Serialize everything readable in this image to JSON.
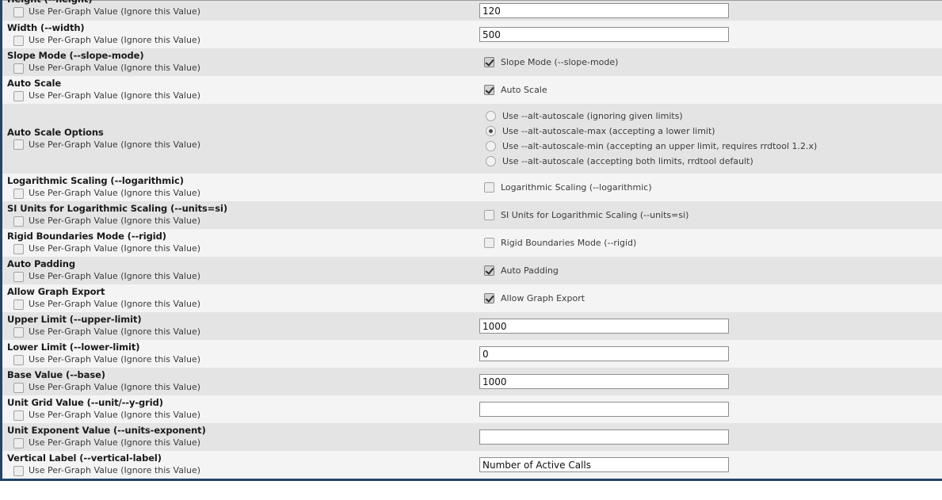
{
  "per_graph_label": "Use Per-Graph Value (Ignore this Value)",
  "rows": [
    {
      "title": "Height (--height)",
      "title_clipped": true,
      "control": "text",
      "value": "120"
    },
    {
      "title": "Width (--width)",
      "control": "text",
      "value": "500"
    },
    {
      "title": "Slope Mode (--slope-mode)",
      "control": "checkbox",
      "checkbox_label": "Slope Mode (--slope-mode)",
      "checked": true
    },
    {
      "title": "Auto Scale",
      "control": "checkbox",
      "checkbox_label": "Auto Scale",
      "checked": true
    },
    {
      "title": "Auto Scale Options",
      "control": "radio",
      "options": [
        {
          "label": "Use --alt-autoscale (ignoring given limits)",
          "selected": false
        },
        {
          "label": "Use --alt-autoscale-max (accepting a lower limit)",
          "selected": true
        },
        {
          "label": "Use --alt-autoscale-min (accepting an upper limit, requires rrdtool 1.2.x)",
          "selected": false
        },
        {
          "label": "Use --alt-autoscale (accepting both limits, rrdtool default)",
          "selected": false
        }
      ]
    },
    {
      "title": "Logarithmic Scaling (--logarithmic)",
      "control": "checkbox",
      "checkbox_label": "Logarithmic Scaling (--logarithmic)",
      "checked": false
    },
    {
      "title": "SI Units for Logarithmic Scaling (--units=si)",
      "control": "checkbox",
      "checkbox_label": "SI Units for Logarithmic Scaling (--units=si)",
      "checked": false
    },
    {
      "title": "Rigid Boundaries Mode (--rigid)",
      "control": "checkbox",
      "checkbox_label": "Rigid Boundaries Mode (--rigid)",
      "checked": false
    },
    {
      "title": "Auto Padding",
      "control": "checkbox",
      "checkbox_label": "Auto Padding",
      "checked": true
    },
    {
      "title": "Allow Graph Export",
      "control": "checkbox",
      "checkbox_label": "Allow Graph Export",
      "checked": true
    },
    {
      "title": "Upper Limit (--upper-limit)",
      "control": "text",
      "value": "1000"
    },
    {
      "title": "Lower Limit (--lower-limit)",
      "control": "text",
      "value": "0"
    },
    {
      "title": "Base Value (--base)",
      "control": "text",
      "value": "1000"
    },
    {
      "title": "Unit Grid Value (--unit/--y-grid)",
      "control": "text",
      "value": ""
    },
    {
      "title": "Unit Exponent Value (--units-exponent)",
      "control": "text",
      "value": ""
    },
    {
      "title": "Vertical Label (--vertical-label)",
      "control": "text",
      "value": "Number of Active Calls"
    }
  ]
}
